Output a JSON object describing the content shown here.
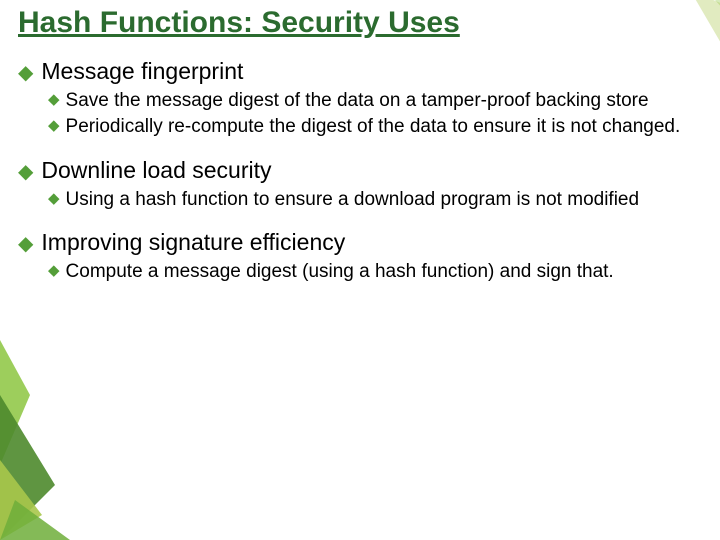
{
  "title": "Hash Functions: Security Uses",
  "sections": [
    {
      "heading": "Message fingerprint",
      "items": [
        "Save the message digest of the data on a tamper-proof backing store",
        "Periodically re-compute the digest of the data to ensure it is not changed."
      ]
    },
    {
      "heading": "Downline load security",
      "items": [
        "Using a hash function to ensure a download program is not modified"
      ]
    },
    {
      "heading": "Improving signature efficiency",
      "items": [
        "Compute a message digest (using a hash function) and sign that."
      ]
    }
  ],
  "colors": {
    "title": "#2b6b2f",
    "bullet": "#549e39",
    "deco_green_dark": "#3d7a1f",
    "deco_green_light": "#7fbf3f",
    "deco_olive": "#a8b84a"
  }
}
